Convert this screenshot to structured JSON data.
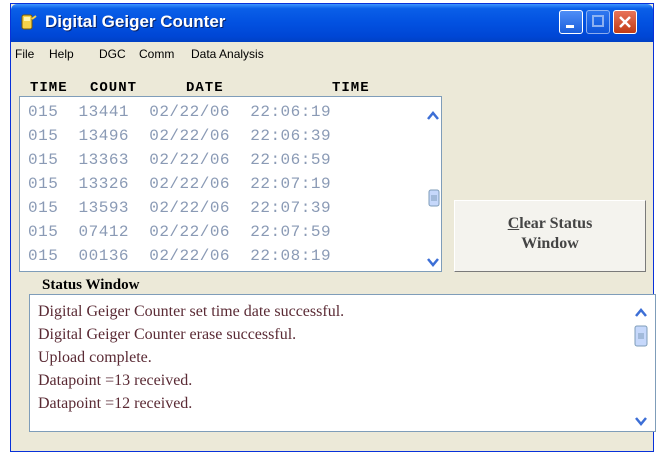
{
  "window": {
    "title": "Digital Geiger Counter"
  },
  "menu": [
    {
      "label": "File"
    },
    {
      "label": "Help"
    },
    {
      "label": "DGC"
    },
    {
      "label": "Comm"
    },
    {
      "label": "Data Analysis"
    }
  ],
  "headers": {
    "time_left": "TIME",
    "count": "COUNT",
    "date": "DATE",
    "time_right": "TIME"
  },
  "rows": [
    "015  13441  02/22/06  22:06:19",
    "015  13496  02/22/06  22:06:39",
    "015  13363  02/22/06  22:06:59",
    "015  13326  02/22/06  22:07:19",
    "015  13593  02/22/06  22:07:39",
    "015  07412  02/22/06  22:07:59",
    "015  00136  02/22/06  22:08:19"
  ],
  "clear_button": {
    "line1_ul": "C",
    "line1_rest": "lear Status",
    "line2": "Window"
  },
  "status": {
    "label": "Status Window",
    "lines": [
      "Digital Geiger Counter set time date successful.",
      "Digital Geiger Counter erase successful.",
      "Upload complete.",
      "Datapoint =13 received.",
      "Datapoint =12 received."
    ]
  }
}
